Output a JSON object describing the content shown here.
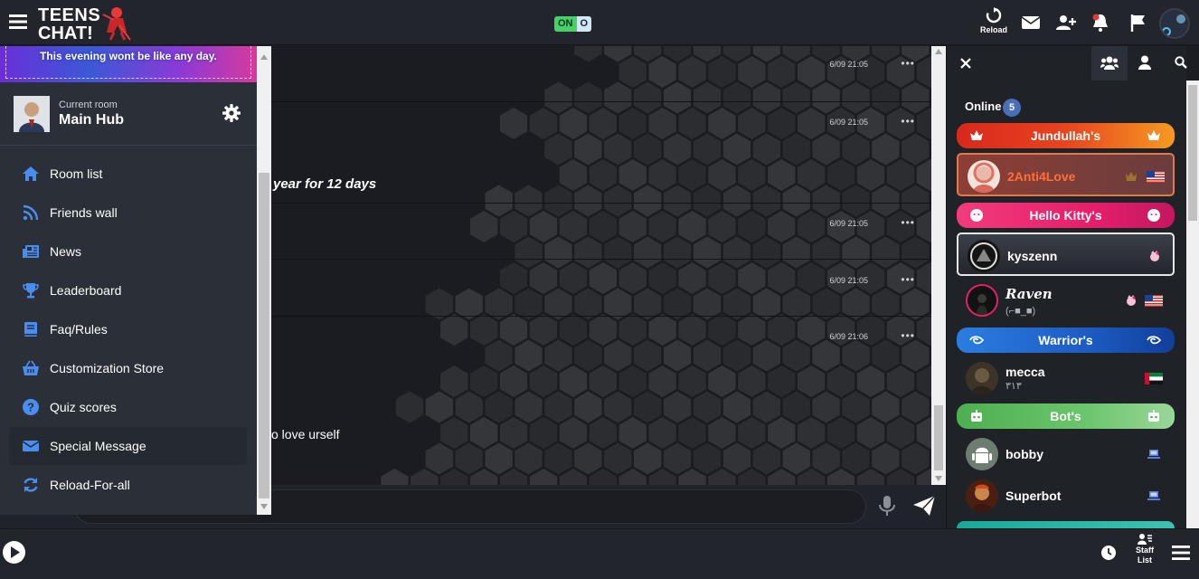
{
  "topbar": {
    "logo_line1": "TEENS",
    "logo_line2": "CHAT!",
    "toggle_on": "ON",
    "toggle_off": "O",
    "reload_label": "Reload"
  },
  "left_panel": {
    "banner_text": "This evening wont be like any day.",
    "room_caption": "Current room",
    "room_name": "Main Hub",
    "nav": [
      {
        "label": "Room list",
        "icon": "home-icon"
      },
      {
        "label": "Friends wall",
        "icon": "rss-icon"
      },
      {
        "label": "News",
        "icon": "newspaper-icon"
      },
      {
        "label": "Leaderboard",
        "icon": "trophy-icon"
      },
      {
        "label": "Faq/Rules",
        "icon": "book-icon"
      },
      {
        "label": "Customization Store",
        "icon": "basket-icon"
      },
      {
        "label": "Quiz scores",
        "icon": "question-icon"
      },
      {
        "label": "Special Message",
        "icon": "envelope-icon"
      },
      {
        "label": "Reload-For-all",
        "icon": "sync-icon"
      }
    ]
  },
  "chat": {
    "messages": [
      {
        "time": "6/09 21:05",
        "text": ""
      },
      {
        "time": "6/09 21:05",
        "text": "year for 12 days"
      },
      {
        "time": "6/09 21:05",
        "text": ""
      },
      {
        "time": "6/09 21:05",
        "text": ""
      },
      {
        "time": "6/09 21:06",
        "text": "o love urself"
      }
    ],
    "more_glyph": "•••"
  },
  "right_panel": {
    "online_label": "Online",
    "online_count": "5",
    "groups": {
      "jundullah": "Jundullah's",
      "hellokitty": "Hello Kitty's",
      "warrior": "Warrior's",
      "bots": "Bot's"
    },
    "users": {
      "anti4love": "2Anti4Love",
      "kyszenn": "kyszenn",
      "raven": "Raven",
      "raven_status": "(⌐■_■)",
      "mecca": "mecca",
      "mecca_status": "٣١٣",
      "bobby": "bobby",
      "superbot": "Superbot"
    }
  },
  "bottombar": {
    "staff_line1": "Staff",
    "staff_line2": "List"
  },
  "colors": {
    "accent_red": "#e63a3a",
    "jundullah_start": "#e03020",
    "jundullah_end": "#f5a020",
    "hellokitty": "#f0307a",
    "warrior": "#1f62c8",
    "bots": "#5cc25c"
  }
}
